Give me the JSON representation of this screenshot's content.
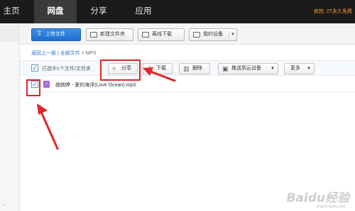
{
  "topnav": {
    "items": [
      {
        "label": "主页"
      },
      {
        "label": "网盘"
      },
      {
        "label": "分享"
      },
      {
        "label": "应用"
      }
    ],
    "promo": "疯抢: 2T永久免费"
  },
  "left_panel": {
    "more": "..."
  },
  "toolbar": {
    "upload_label": "上传文件",
    "new_folder_label": "新建文件夹",
    "offline_label": "离线下载",
    "devices_label": "我的设备"
  },
  "breadcrumb": {
    "back": "返回上一级",
    "separator1": "|",
    "all_files": "全部文件",
    "separator2": ">",
    "current": "MP3"
  },
  "actionbar": {
    "selected_text": "已选中1个文件/文件夹",
    "share_label": "分享",
    "download_label": "下载",
    "delete_label": "删除",
    "push_label": "推送到云设备",
    "more_label": "更多"
  },
  "file": {
    "name": "曲婉婷 - 爱的海洋(Love Ocean).mp3",
    "checked": true
  },
  "watermark": {
    "text": "Baidu经验",
    "sub": "jingyan.baidu.com"
  },
  "colors": {
    "nav_bg": "#1b1b1b",
    "accent_blue": "#1e6fcf",
    "highlight_red": "#e0262a",
    "promo_orange": "#e8963a",
    "music_icon": "#9b6fd6"
  }
}
